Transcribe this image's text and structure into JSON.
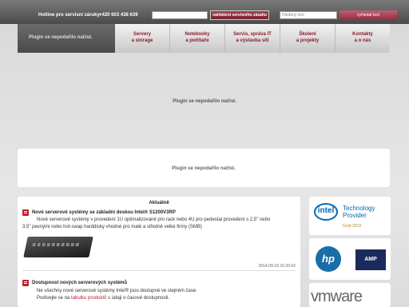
{
  "header": {
    "hotline_label": "Hotline pro servisní záruky:",
    "hotline_phone": "+420 603 438 639",
    "service_button": "nahlášení servisního zásahu",
    "search_placeholder": "Hledaný text",
    "search_button": "vyhledat text"
  },
  "logo_plugin_text": "Plugin se nepodařilo načíst.",
  "nav": {
    "items": [
      {
        "line1": "Servery",
        "line2": "a storage"
      },
      {
        "line1": "Notebooky",
        "line2": "a počítače"
      },
      {
        "line1": "Servis, správa IT",
        "line2": "a výstavba sítí"
      },
      {
        "line1": "Školení",
        "line2": "a projekty"
      },
      {
        "line1": "Kontakty",
        "line2": "a o nás"
      }
    ]
  },
  "plugin_main_text": "Plugin se nepodařilo načíst.",
  "plugin_box_text": "Plugin se nepodařilo načíst.",
  "news": {
    "title": "Aktuálně",
    "items": [
      {
        "heading": "Nové serverové systémy se základní deskou Intel® S1200V3RP",
        "body_line1": "Nové serverové systémy v provedení 1U optimalizované pro rack nebo 4U pro pedestal provedení s 2,5\" nebo",
        "body_line2": "3,5\" pevnými nebo hot-swap harddisky vhodné pro malé a středně velké firmy (SMB)",
        "date": "2014-09-23 15:20:42"
      },
      {
        "heading": "Dostupnost nových serverových systémů",
        "body_line1": "Ne všechny nové serverové systémy Intel® jsou dostupné ve stejném čase.",
        "body_pre": "Podívejte se na ",
        "body_link": "tabulku produktů",
        "body_post": " s údaji o časové dostupnosti."
      }
    ]
  },
  "partners": {
    "intel": {
      "badge": "intel",
      "line1": "Technology",
      "line2": "Provider",
      "level": "Gold 2019"
    },
    "hp": {
      "logo": "hp"
    },
    "amp": {
      "logo": "AMP"
    },
    "vmware": {
      "logo": "vmware"
    }
  }
}
